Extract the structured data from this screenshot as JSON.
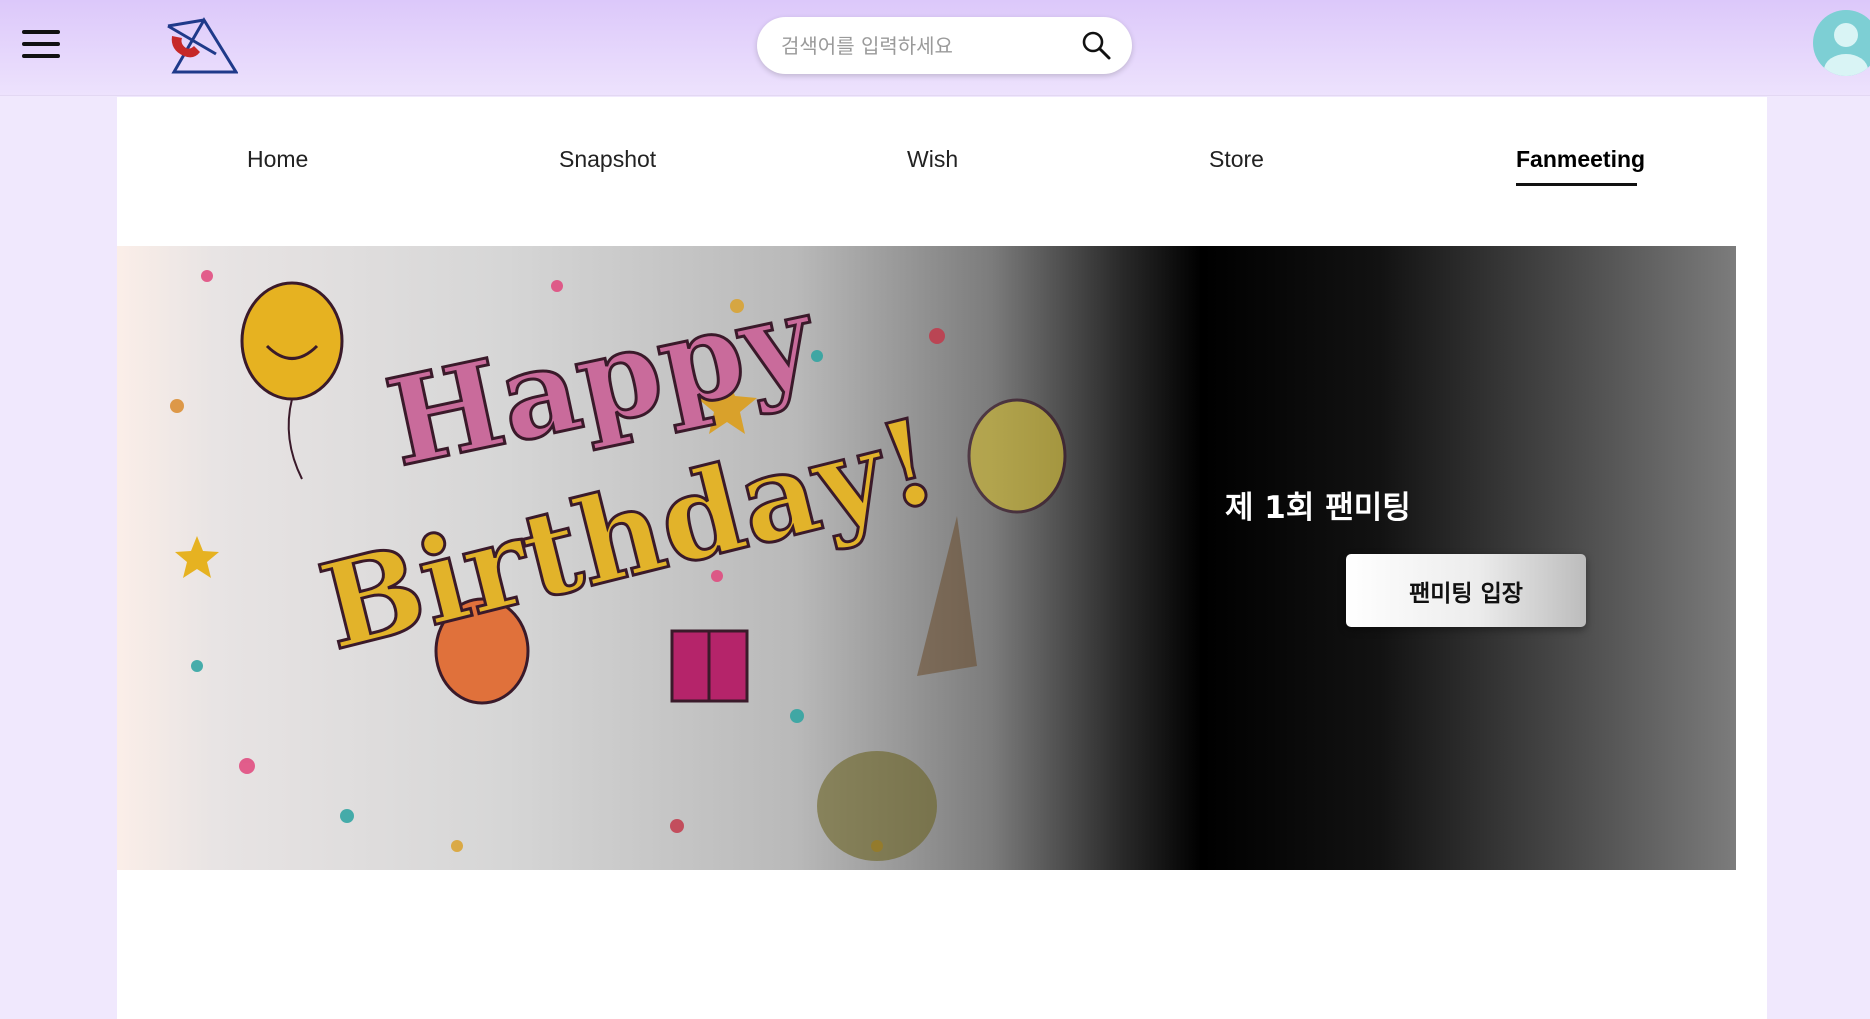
{
  "header": {
    "menu_icon": "hamburger-menu-icon",
    "logo_icon": "logo-icon",
    "search": {
      "placeholder": "검색어를 입력하세요",
      "value": "",
      "icon": "search-icon"
    },
    "avatar_icon": "user-avatar-icon"
  },
  "nav": {
    "tabs": [
      {
        "label": "Home",
        "active": false
      },
      {
        "label": "Snapshot",
        "active": false
      },
      {
        "label": "Wish",
        "active": false
      },
      {
        "label": "Store",
        "active": false
      },
      {
        "label": "Fanmeeting",
        "active": true
      }
    ]
  },
  "banner": {
    "title": "제 1회 팬미팅",
    "button_label": "팬미팅 입장",
    "image_text": "Happy Birthday!"
  },
  "colors": {
    "header_bg": "#dcc8fa",
    "page_bg": "#f0e8fd",
    "avatar": "#7dcfd4",
    "logo_red": "#c62828",
    "logo_blue": "#1f3a8a"
  }
}
